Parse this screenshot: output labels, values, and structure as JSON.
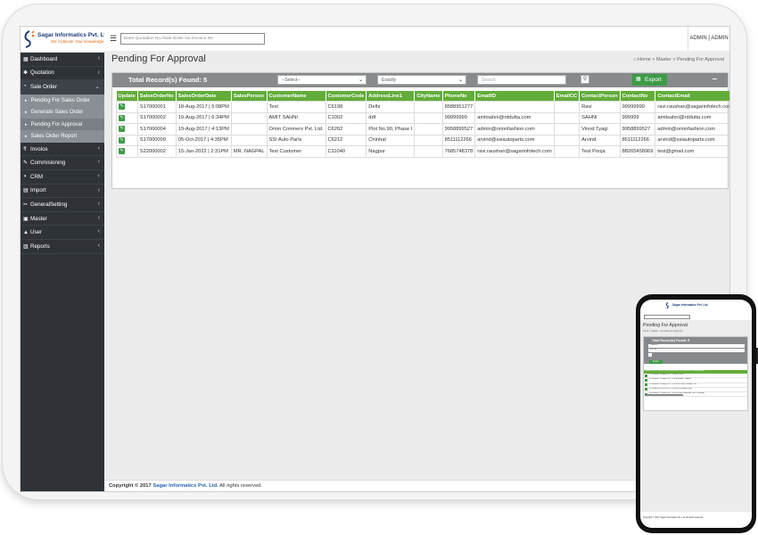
{
  "brand": {
    "name": "Sagar Informatics Pvt. Ltd.",
    "tagline": "We Cultivate Your Knowledge"
  },
  "topbar": {
    "search_placeholder": "Enter Quotation No./Sale Order No./Invoice No",
    "user": "ADMIN [ ADMIN ]"
  },
  "sidebar": {
    "items": [
      {
        "label": "Dashboard",
        "icon": "dashboard-icon",
        "glyph": "▦"
      },
      {
        "label": "Quotation",
        "icon": "gear-icon",
        "glyph": "✱"
      },
      {
        "label": "Sale Order",
        "icon": "cart-icon",
        "glyph": "◔"
      }
    ],
    "sub_items": [
      {
        "label": "Pending For Sales Order"
      },
      {
        "label": "Generate Sales Order"
      },
      {
        "label": "Pending For Approval"
      },
      {
        "label": "Sales Order Report"
      }
    ],
    "items2": [
      {
        "label": "Invoice",
        "icon": "rupee-icon",
        "glyph": "₹"
      },
      {
        "label": "Commisioning",
        "icon": "wrench-icon",
        "glyph": "✎"
      },
      {
        "label": "CRM",
        "icon": "users-icon",
        "glyph": "◑"
      },
      {
        "label": "Import",
        "icon": "import-icon",
        "glyph": "▤"
      },
      {
        "label": "GeneralSetting",
        "icon": "tools-icon",
        "glyph": "✂"
      },
      {
        "label": "Master",
        "icon": "briefcase-icon",
        "glyph": "▣"
      },
      {
        "label": "User",
        "icon": "user-icon",
        "glyph": "▲"
      },
      {
        "label": "Reports",
        "icon": "report-icon",
        "glyph": "▥"
      }
    ]
  },
  "page": {
    "title": "Pending For Approval"
  },
  "breadcrumb": {
    "home": "Home",
    "sep": ">",
    "section": "Master",
    "current": "Pending For Approval"
  },
  "panel": {
    "total": "Total Record(s) Found: 5",
    "select1": "--Select--",
    "select2": "Exactly",
    "search_placeholder": "Search",
    "export_label": "Export",
    "collapse": "–"
  },
  "table": {
    "columns": [
      "Update",
      "SalesOrderNo",
      "SalesOrderDate",
      "SalesPerson",
      "CustomerName",
      "CustomerCode",
      "AddressLine1",
      "CityName",
      "PhoneNo",
      "EmailID",
      "EmailCC",
      "ContactPerson",
      "ContactNo",
      "ContactEmail"
    ],
    "rows": [
      [
        "S17000001",
        "18-Aug-2017 | 5:08PM",
        "",
        "Test",
        "C6198",
        "Delhi",
        "",
        "8588951277",
        "",
        "",
        "Ravi",
        "99999999",
        "ravi.raushan@sagarinfotech.com"
      ],
      [
        "S17000002",
        "19-Aug-2017 | 6:34PM",
        "",
        "AMIT SAHNI",
        "C1002",
        "ddf",
        "",
        "99999999",
        "amitsahni@rddutta.com",
        "",
        "SAHNI",
        "999999",
        "amitsahni@rddutta.com"
      ],
      [
        "S17000004",
        "19-Aug-2017 | 4:13PM",
        "",
        "Orion Conmerx Pvt. Ltd.",
        "C6262",
        "Plot No.90, Phase I",
        "",
        "9958899527",
        "admin@orionfashion.com",
        "",
        "Vinod Tyagi",
        "9958899527",
        "admin@orionfashion.com"
      ],
      [
        "S17000009",
        "05-Oct-2017 | 4:35PM",
        "",
        "SSI Auto Parts",
        "C6212",
        "Chinhat",
        "",
        "8511112266",
        "arvind@ssiautoparts.com",
        "",
        "Arvind",
        "8511112266",
        "arvind@ssiautoparts.com"
      ],
      [
        "S22000002",
        "15-Jan-2022 | 2:31PM",
        "MR. NAGPAL",
        "Test Customer",
        "C11040",
        "Nagpur",
        "",
        "7685748378",
        "ravi.raushan@sagarinfotech.com",
        "",
        "Test Pooja",
        "88265458969",
        "test@gmail.com"
      ]
    ]
  },
  "footer": {
    "prefix": "Copyright © 2017",
    "company": "Sagar Informatics Pvt. Ltd.",
    "suffix": "All rights reserved."
  },
  "phone": {
    "title": "Pending For Approval",
    "crumb": "Home > Master > Pending For Approval",
    "total": "Total Record(s) Found: 5",
    "select1": "--Select--",
    "select2": "Exactly",
    "export_label": "Export",
    "header": "Update SalesOrderNo SalesOrderDate SalesPerson CustomerName",
    "rows": [
      "S17000001   18-Aug-2017 | 5:08PM   Test",
      "S17000002   19-Aug-2017 | 6:34PM   AMIT SAHNI",
      "S17000004   19-Aug-2017 | 4:13PM   Orion Conmerx Pvt",
      "S17000009   05-Oct-2017 | 4:35PM   SSI Auto Parts",
      "S22000002   15-Jan-2022 | 2:31PM  MR. NAGPAL  Test Customer"
    ],
    "footer": "Copyright © 2017 Sagar Informatics Pvt. Ltd. All rights reserved."
  },
  "colors": {
    "sidebar": "#2f3338",
    "accent_green": "#62ad3a",
    "button_green": "#3e9b47",
    "panel_header": "#878a8d"
  }
}
